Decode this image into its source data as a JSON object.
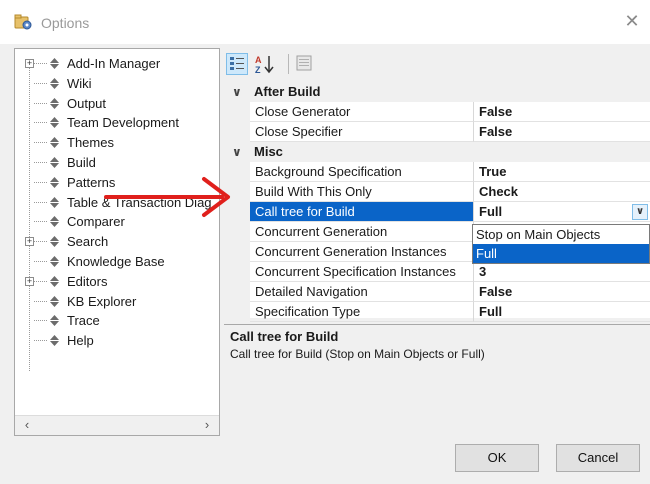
{
  "window": {
    "title": "Options"
  },
  "tree": {
    "items": [
      {
        "label": "Add-In Manager",
        "expandable": true
      },
      {
        "label": "Wiki",
        "expandable": false
      },
      {
        "label": "Output",
        "expandable": false
      },
      {
        "label": "Team Development",
        "expandable": false
      },
      {
        "label": "Themes",
        "expandable": false
      },
      {
        "label": "Build",
        "expandable": false
      },
      {
        "label": "Patterns",
        "expandable": false
      },
      {
        "label": "Table & Transaction Diag",
        "expandable": false
      },
      {
        "label": "Comparer",
        "expandable": false
      },
      {
        "label": "Search",
        "expandable": true
      },
      {
        "label": "Knowledge Base",
        "expandable": false
      },
      {
        "label": "Editors",
        "expandable": true
      },
      {
        "label": "KB Explorer",
        "expandable": false
      },
      {
        "label": "Trace",
        "expandable": false
      },
      {
        "label": "Help",
        "expandable": false
      }
    ]
  },
  "toolbar": {
    "categorized_icon": "categorized-icon",
    "alphabetical_icon": "alphabetical-sort-icon",
    "property_pages_icon": "property-pages-icon"
  },
  "grid": {
    "categories": [
      {
        "name": "After Build",
        "properties": [
          {
            "name": "Close Generator",
            "value": "False"
          },
          {
            "name": "Close Specifier",
            "value": "False"
          }
        ]
      },
      {
        "name": "Misc",
        "properties": [
          {
            "name": "Background Specification",
            "value": "True"
          },
          {
            "name": "Build With This Only",
            "value": "Check"
          },
          {
            "name": "Call tree for Build",
            "value": "Full"
          },
          {
            "name": "Concurrent Generation",
            "value": ""
          },
          {
            "name": "Concurrent Generation Instances",
            "value": ""
          },
          {
            "name": "Concurrent Specification Instances",
            "value": "3"
          },
          {
            "name": "Detailed Navigation",
            "value": "False"
          },
          {
            "name": "Specification Type",
            "value": "Full"
          }
        ]
      }
    ],
    "dropdown_options": [
      "Stop on Main Objects",
      "Full"
    ]
  },
  "description": {
    "title": "Call tree for Build",
    "text": "Call tree for Build (Stop on Main Objects or Full)"
  },
  "buttons": {
    "ok": "OK",
    "cancel": "Cancel"
  },
  "colors": {
    "selection": "#0a64c8",
    "annotation_arrow": "#e0201c"
  }
}
